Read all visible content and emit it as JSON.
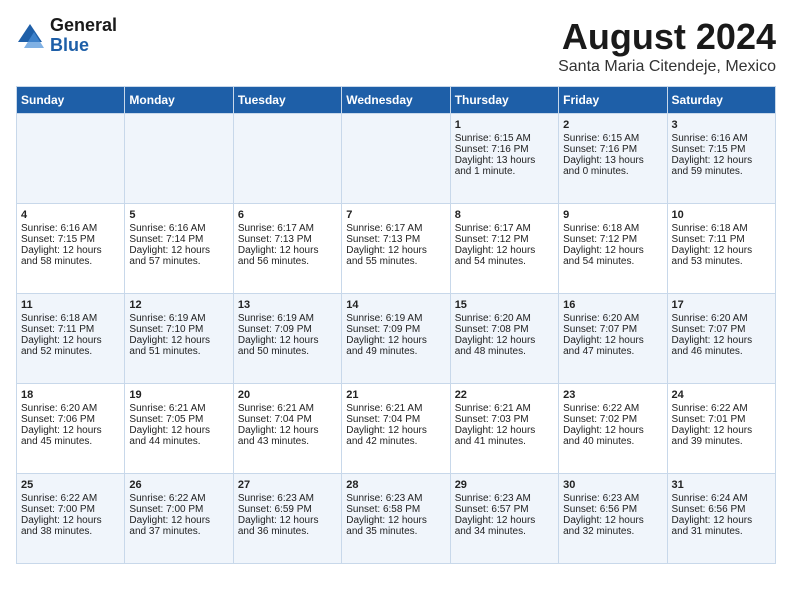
{
  "logo": {
    "general": "General",
    "blue": "Blue"
  },
  "title": "August 2024",
  "subtitle": "Santa Maria Citendeje, Mexico",
  "days_of_week": [
    "Sunday",
    "Monday",
    "Tuesday",
    "Wednesday",
    "Thursday",
    "Friday",
    "Saturday"
  ],
  "weeks": [
    [
      {
        "day": "",
        "content": ""
      },
      {
        "day": "",
        "content": ""
      },
      {
        "day": "",
        "content": ""
      },
      {
        "day": "",
        "content": ""
      },
      {
        "day": "1",
        "content": "Sunrise: 6:15 AM\nSunset: 7:16 PM\nDaylight: 13 hours\nand 1 minute."
      },
      {
        "day": "2",
        "content": "Sunrise: 6:15 AM\nSunset: 7:16 PM\nDaylight: 13 hours\nand 0 minutes."
      },
      {
        "day": "3",
        "content": "Sunrise: 6:16 AM\nSunset: 7:15 PM\nDaylight: 12 hours\nand 59 minutes."
      }
    ],
    [
      {
        "day": "4",
        "content": "Sunrise: 6:16 AM\nSunset: 7:15 PM\nDaylight: 12 hours\nand 58 minutes."
      },
      {
        "day": "5",
        "content": "Sunrise: 6:16 AM\nSunset: 7:14 PM\nDaylight: 12 hours\nand 57 minutes."
      },
      {
        "day": "6",
        "content": "Sunrise: 6:17 AM\nSunset: 7:13 PM\nDaylight: 12 hours\nand 56 minutes."
      },
      {
        "day": "7",
        "content": "Sunrise: 6:17 AM\nSunset: 7:13 PM\nDaylight: 12 hours\nand 55 minutes."
      },
      {
        "day": "8",
        "content": "Sunrise: 6:17 AM\nSunset: 7:12 PM\nDaylight: 12 hours\nand 54 minutes."
      },
      {
        "day": "9",
        "content": "Sunrise: 6:18 AM\nSunset: 7:12 PM\nDaylight: 12 hours\nand 54 minutes."
      },
      {
        "day": "10",
        "content": "Sunrise: 6:18 AM\nSunset: 7:11 PM\nDaylight: 12 hours\nand 53 minutes."
      }
    ],
    [
      {
        "day": "11",
        "content": "Sunrise: 6:18 AM\nSunset: 7:11 PM\nDaylight: 12 hours\nand 52 minutes."
      },
      {
        "day": "12",
        "content": "Sunrise: 6:19 AM\nSunset: 7:10 PM\nDaylight: 12 hours\nand 51 minutes."
      },
      {
        "day": "13",
        "content": "Sunrise: 6:19 AM\nSunset: 7:09 PM\nDaylight: 12 hours\nand 50 minutes."
      },
      {
        "day": "14",
        "content": "Sunrise: 6:19 AM\nSunset: 7:09 PM\nDaylight: 12 hours\nand 49 minutes."
      },
      {
        "day": "15",
        "content": "Sunrise: 6:20 AM\nSunset: 7:08 PM\nDaylight: 12 hours\nand 48 minutes."
      },
      {
        "day": "16",
        "content": "Sunrise: 6:20 AM\nSunset: 7:07 PM\nDaylight: 12 hours\nand 47 minutes."
      },
      {
        "day": "17",
        "content": "Sunrise: 6:20 AM\nSunset: 7:07 PM\nDaylight: 12 hours\nand 46 minutes."
      }
    ],
    [
      {
        "day": "18",
        "content": "Sunrise: 6:20 AM\nSunset: 7:06 PM\nDaylight: 12 hours\nand 45 minutes."
      },
      {
        "day": "19",
        "content": "Sunrise: 6:21 AM\nSunset: 7:05 PM\nDaylight: 12 hours\nand 44 minutes."
      },
      {
        "day": "20",
        "content": "Sunrise: 6:21 AM\nSunset: 7:04 PM\nDaylight: 12 hours\nand 43 minutes."
      },
      {
        "day": "21",
        "content": "Sunrise: 6:21 AM\nSunset: 7:04 PM\nDaylight: 12 hours\nand 42 minutes."
      },
      {
        "day": "22",
        "content": "Sunrise: 6:21 AM\nSunset: 7:03 PM\nDaylight: 12 hours\nand 41 minutes."
      },
      {
        "day": "23",
        "content": "Sunrise: 6:22 AM\nSunset: 7:02 PM\nDaylight: 12 hours\nand 40 minutes."
      },
      {
        "day": "24",
        "content": "Sunrise: 6:22 AM\nSunset: 7:01 PM\nDaylight: 12 hours\nand 39 minutes."
      }
    ],
    [
      {
        "day": "25",
        "content": "Sunrise: 6:22 AM\nSunset: 7:00 PM\nDaylight: 12 hours\nand 38 minutes."
      },
      {
        "day": "26",
        "content": "Sunrise: 6:22 AM\nSunset: 7:00 PM\nDaylight: 12 hours\nand 37 minutes."
      },
      {
        "day": "27",
        "content": "Sunrise: 6:23 AM\nSunset: 6:59 PM\nDaylight: 12 hours\nand 36 minutes."
      },
      {
        "day": "28",
        "content": "Sunrise: 6:23 AM\nSunset: 6:58 PM\nDaylight: 12 hours\nand 35 minutes."
      },
      {
        "day": "29",
        "content": "Sunrise: 6:23 AM\nSunset: 6:57 PM\nDaylight: 12 hours\nand 34 minutes."
      },
      {
        "day": "30",
        "content": "Sunrise: 6:23 AM\nSunset: 6:56 PM\nDaylight: 12 hours\nand 32 minutes."
      },
      {
        "day": "31",
        "content": "Sunrise: 6:24 AM\nSunset: 6:56 PM\nDaylight: 12 hours\nand 31 minutes."
      }
    ]
  ]
}
